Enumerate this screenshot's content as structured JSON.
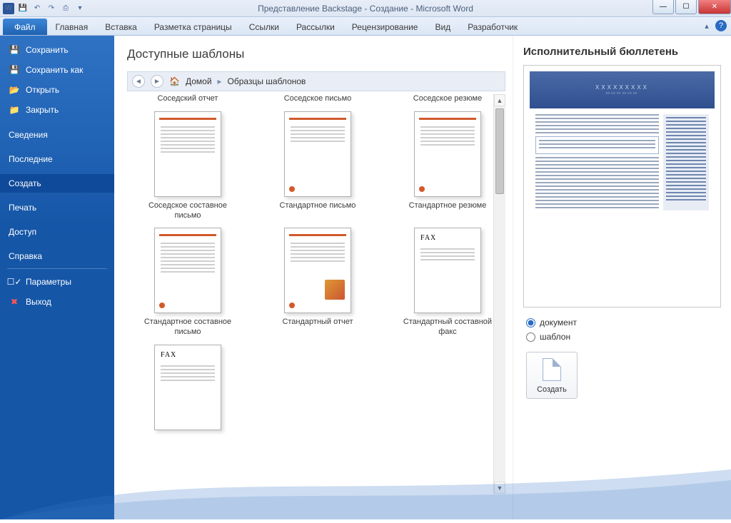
{
  "title": "Представление Backstage - Создание  -  Microsoft Word",
  "ribbon": {
    "file": "Файл",
    "tabs": [
      "Главная",
      "Вставка",
      "Разметка страницы",
      "Ссылки",
      "Рассылки",
      "Рецензирование",
      "Вид",
      "Разработчик"
    ]
  },
  "side": {
    "save": "Сохранить",
    "saveas": "Сохранить как",
    "open": "Открыть",
    "close": "Закрыть",
    "info": "Сведения",
    "recent": "Последние",
    "new": "Создать",
    "print": "Печать",
    "share": "Доступ",
    "help": "Справка",
    "options": "Параметры",
    "exit": "Выход"
  },
  "center": {
    "heading": "Доступные шаблоны",
    "home": "Домой",
    "crumb": "Образцы шаблонов",
    "row1": [
      "Соседский отчет",
      "Соседское письмо",
      "Соседское резюме"
    ],
    "row2": [
      "Соседское составное письмо",
      "Стандартное письмо",
      "Стандартное резюме"
    ],
    "row3": [
      "Стандартное составное письмо",
      "Стандартный отчет",
      "Стандартный составной факс"
    ]
  },
  "right": {
    "heading": "Исполнительный бюллетень",
    "opt_doc": "документ",
    "opt_tpl": "шаблон",
    "create": "Создать",
    "preview_placeholder": "XXXXXXXXX"
  }
}
